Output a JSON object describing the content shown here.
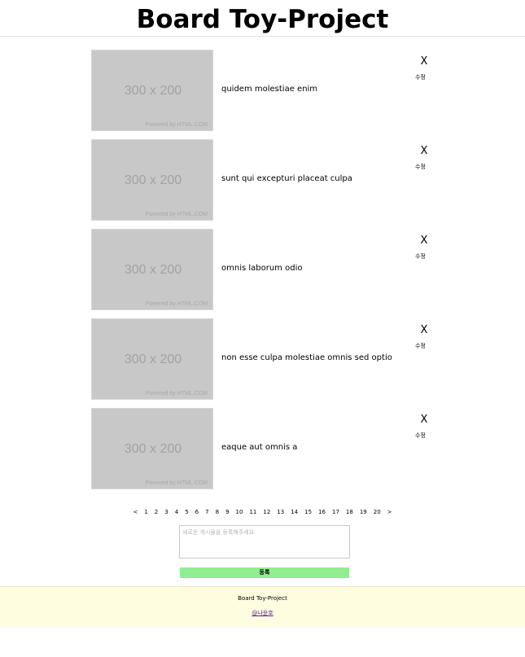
{
  "header": {
    "title": "Board Toy-Project"
  },
  "thumbnail": {
    "size_text": "300 x 200",
    "powered_text": "Powered by HTML.COM"
  },
  "posts": [
    {
      "title": "quidem molestiae enim",
      "delete_label": "X",
      "edit_label": "수정"
    },
    {
      "title": "sunt qui excepturi placeat culpa",
      "delete_label": "X",
      "edit_label": "수정"
    },
    {
      "title": "omnis laborum odio",
      "delete_label": "X",
      "edit_label": "수정"
    },
    {
      "title": "non esse culpa molestiae omnis sed optio",
      "delete_label": "X",
      "edit_label": "수정"
    },
    {
      "title": "eaque aut omnis a",
      "delete_label": "X",
      "edit_label": "수정"
    }
  ],
  "pagination": {
    "prev": "<",
    "pages": [
      "1",
      "2",
      "3",
      "4",
      "5",
      "6",
      "7",
      "8",
      "9",
      "10",
      "11",
      "12",
      "13",
      "14",
      "15",
      "16",
      "17",
      "18",
      "19",
      "20"
    ],
    "next": ">"
  },
  "new_post": {
    "placeholder": "새로운 게시물을 등록해주세요",
    "value": ""
  },
  "submit": {
    "label": "등록"
  },
  "footer": {
    "title": "Board Toy-Project",
    "author_link": "@나윤호"
  },
  "colors": {
    "submit_bg": "#90ee90",
    "footer_bg": "#fffde0",
    "thumb_bg": "#c8c8c8"
  }
}
